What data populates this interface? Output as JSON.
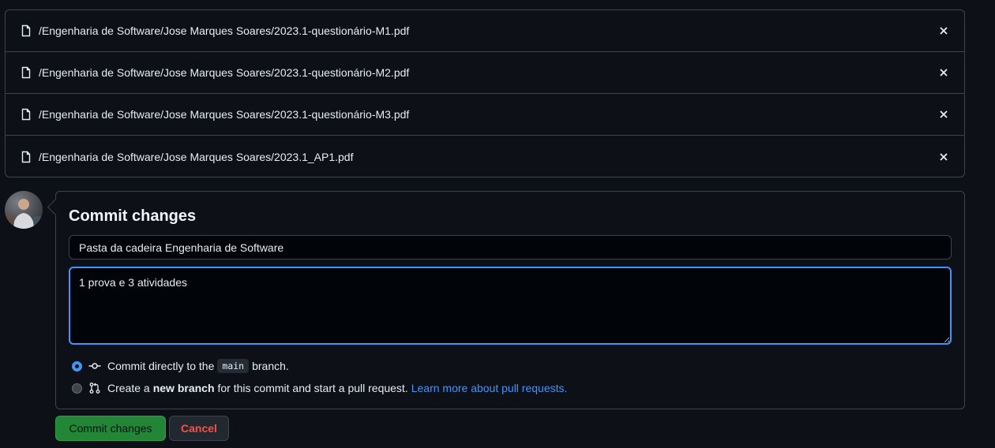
{
  "files": [
    {
      "path": "/Engenharia de Software/Jose Marques Soares/2023.1-questionário-M1.pdf",
      "icon": "file-icon",
      "remove_icon": "x-icon"
    },
    {
      "path": "/Engenharia de Software/Jose Marques Soares/2023.1-questionário-M2.pdf",
      "icon": "file-icon",
      "remove_icon": "x-icon"
    },
    {
      "path": "/Engenharia de Software/Jose Marques Soares/2023.1-questionário-M3.pdf",
      "icon": "file-icon",
      "remove_icon": "x-icon"
    },
    {
      "path": "/Engenharia de Software/Jose Marques Soares/2023.1_AP1.pdf",
      "icon": "file-icon",
      "remove_icon": "x-icon"
    }
  ],
  "commit": {
    "title": "Commit changes",
    "summary_value": "Pasta da cadeira Engenharia de Software",
    "description_value": "1 prova e 3 atividades",
    "option_direct": {
      "selected": true,
      "text_before": "Commit directly to the",
      "branch": "main",
      "text_after": "branch."
    },
    "option_new_branch": {
      "selected": false,
      "text_before": "Create a",
      "bold": "new branch",
      "text_after": "for this commit and start a pull request.",
      "link": "Learn more about pull requests."
    }
  },
  "buttons": {
    "commit_label": "Commit changes",
    "cancel_label": "Cancel"
  },
  "colors": {
    "background": "#0d1117",
    "border": "#3d444d",
    "accent": "#4493f8",
    "primary_button": "#238636",
    "danger_text": "#f85149"
  }
}
